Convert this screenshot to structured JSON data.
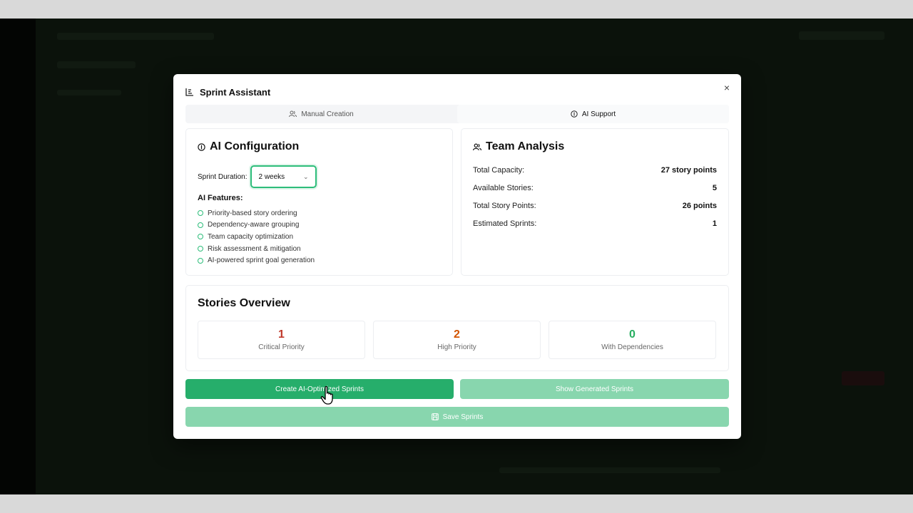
{
  "modal": {
    "title": "Sprint Assistant",
    "close_symbol": "×"
  },
  "tabs": [
    {
      "label": "Manual Creation",
      "icon": "users-icon",
      "active": false
    },
    {
      "label": "AI Support",
      "icon": "info-icon",
      "active": true
    }
  ],
  "ai_config": {
    "title": "AI Configuration",
    "duration_label": "Sprint Duration:",
    "duration_value": "2 weeks",
    "features_title": "AI Features:",
    "features": [
      "Priority-based story ordering",
      "Dependency-aware grouping",
      "Team capacity optimization",
      "Risk assessment & mitigation",
      "AI-powered sprint goal generation"
    ]
  },
  "team_analysis": {
    "title": "Team Analysis",
    "rows": [
      {
        "label": "Total Capacity:",
        "value": "27 story points"
      },
      {
        "label": "Available Stories:",
        "value": "5"
      },
      {
        "label": "Total Story Points:",
        "value": "26 points"
      },
      {
        "label": "Estimated Sprints:",
        "value": "1"
      }
    ]
  },
  "stories_overview": {
    "title": "Stories Overview",
    "boxes": [
      {
        "value": "1",
        "label": "Critical Priority",
        "color": "#c0392b"
      },
      {
        "value": "2",
        "label": "High Priority",
        "color": "#d35400"
      },
      {
        "value": "0",
        "label": "With Dependencies",
        "color": "#27ae60"
      }
    ]
  },
  "buttons": {
    "create": "Create AI-Optimized Sprints",
    "show": "Show Generated Sprints",
    "save": "Save Sprints"
  },
  "colors": {
    "accent": "#26ae6b",
    "accent_light": "#88d6ae"
  }
}
